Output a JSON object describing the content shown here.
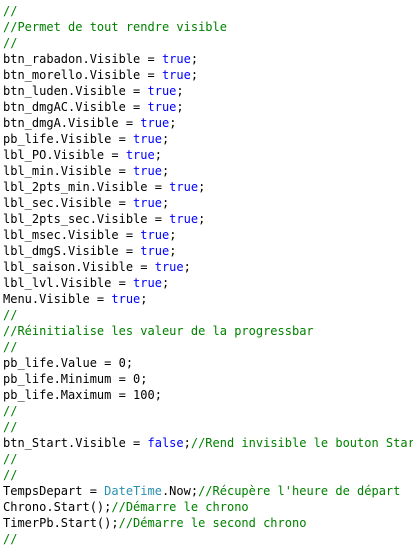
{
  "colors": {
    "comment": "#008000",
    "keyword": "#0000ff",
    "type": "#2b91af",
    "plain": "#000000"
  },
  "code_lines": [
    [
      {
        "t": "//",
        "k": "comment"
      }
    ],
    [
      {
        "t": "//Permet de tout rendre visible",
        "k": "comment"
      }
    ],
    [
      {
        "t": "//",
        "k": "comment"
      }
    ],
    [
      {
        "t": "btn_rabadon.Visible = ",
        "k": "plain"
      },
      {
        "t": "true",
        "k": "keyword"
      },
      {
        "t": ";",
        "k": "plain"
      }
    ],
    [
      {
        "t": "btn_morello.Visible = ",
        "k": "plain"
      },
      {
        "t": "true",
        "k": "keyword"
      },
      {
        "t": ";",
        "k": "plain"
      }
    ],
    [
      {
        "t": "btn_luden.Visible = ",
        "k": "plain"
      },
      {
        "t": "true",
        "k": "keyword"
      },
      {
        "t": ";",
        "k": "plain"
      }
    ],
    [
      {
        "t": "btn_dmgAC.Visible = ",
        "k": "plain"
      },
      {
        "t": "true",
        "k": "keyword"
      },
      {
        "t": ";",
        "k": "plain"
      }
    ],
    [
      {
        "t": "btn_dmgA.Visible = ",
        "k": "plain"
      },
      {
        "t": "true",
        "k": "keyword"
      },
      {
        "t": ";",
        "k": "plain"
      }
    ],
    [
      {
        "t": "pb_life.Visible = ",
        "k": "plain"
      },
      {
        "t": "true",
        "k": "keyword"
      },
      {
        "t": ";",
        "k": "plain"
      }
    ],
    [
      {
        "t": "lbl_PO.Visible = ",
        "k": "plain"
      },
      {
        "t": "true",
        "k": "keyword"
      },
      {
        "t": ";",
        "k": "plain"
      }
    ],
    [
      {
        "t": "lbl_min.Visible = ",
        "k": "plain"
      },
      {
        "t": "true",
        "k": "keyword"
      },
      {
        "t": ";",
        "k": "plain"
      }
    ],
    [
      {
        "t": "lbl_2pts_min.Visible = ",
        "k": "plain"
      },
      {
        "t": "true",
        "k": "keyword"
      },
      {
        "t": ";",
        "k": "plain"
      }
    ],
    [
      {
        "t": "lbl_sec.Visible = ",
        "k": "plain"
      },
      {
        "t": "true",
        "k": "keyword"
      },
      {
        "t": ";",
        "k": "plain"
      }
    ],
    [
      {
        "t": "lbl_2pts_sec.Visible = ",
        "k": "plain"
      },
      {
        "t": "true",
        "k": "keyword"
      },
      {
        "t": ";",
        "k": "plain"
      }
    ],
    [
      {
        "t": "lbl_msec.Visible = ",
        "k": "plain"
      },
      {
        "t": "true",
        "k": "keyword"
      },
      {
        "t": ";",
        "k": "plain"
      }
    ],
    [
      {
        "t": "lbl_dmgS.Visible = ",
        "k": "plain"
      },
      {
        "t": "true",
        "k": "keyword"
      },
      {
        "t": ";",
        "k": "plain"
      }
    ],
    [
      {
        "t": "lbl_saison.Visible = ",
        "k": "plain"
      },
      {
        "t": "true",
        "k": "keyword"
      },
      {
        "t": ";",
        "k": "plain"
      }
    ],
    [
      {
        "t": "lbl_lvl.Visible = ",
        "k": "plain"
      },
      {
        "t": "true",
        "k": "keyword"
      },
      {
        "t": ";",
        "k": "plain"
      }
    ],
    [
      {
        "t": "Menu.Visible = ",
        "k": "plain"
      },
      {
        "t": "true",
        "k": "keyword"
      },
      {
        "t": ";",
        "k": "plain"
      }
    ],
    [
      {
        "t": "//",
        "k": "comment"
      }
    ],
    [
      {
        "t": "//Réinitialise les valeur de la progressbar",
        "k": "comment"
      }
    ],
    [
      {
        "t": "//",
        "k": "comment"
      }
    ],
    [
      {
        "t": "pb_life.Value = 0;",
        "k": "plain"
      }
    ],
    [
      {
        "t": "pb_life.Minimum = 0;",
        "k": "plain"
      }
    ],
    [
      {
        "t": "pb_life.Maximum = 100;",
        "k": "plain"
      }
    ],
    [
      {
        "t": "//",
        "k": "comment"
      }
    ],
    [
      {
        "t": "//",
        "k": "comment"
      }
    ],
    [
      {
        "t": "btn_Start.Visible = ",
        "k": "plain"
      },
      {
        "t": "false",
        "k": "keyword"
      },
      {
        "t": ";",
        "k": "plain"
      },
      {
        "t": "//Rend invisible le bouton Start",
        "k": "comment"
      }
    ],
    [
      {
        "t": "//",
        "k": "comment"
      }
    ],
    [
      {
        "t": "//",
        "k": "comment"
      }
    ],
    [
      {
        "t": "TempsDepart = ",
        "k": "plain"
      },
      {
        "t": "DateTime",
        "k": "type"
      },
      {
        "t": ".Now;",
        "k": "plain"
      },
      {
        "t": "//Récupère l'heure de départ",
        "k": "comment"
      }
    ],
    [
      {
        "t": "Chrono.Start();",
        "k": "plain"
      },
      {
        "t": "//Démarre le chrono",
        "k": "comment"
      }
    ],
    [
      {
        "t": "TimerPb.Start();",
        "k": "plain"
      },
      {
        "t": "//Démarre le second chrono",
        "k": "comment"
      }
    ],
    [
      {
        "t": "//",
        "k": "comment"
      }
    ]
  ]
}
